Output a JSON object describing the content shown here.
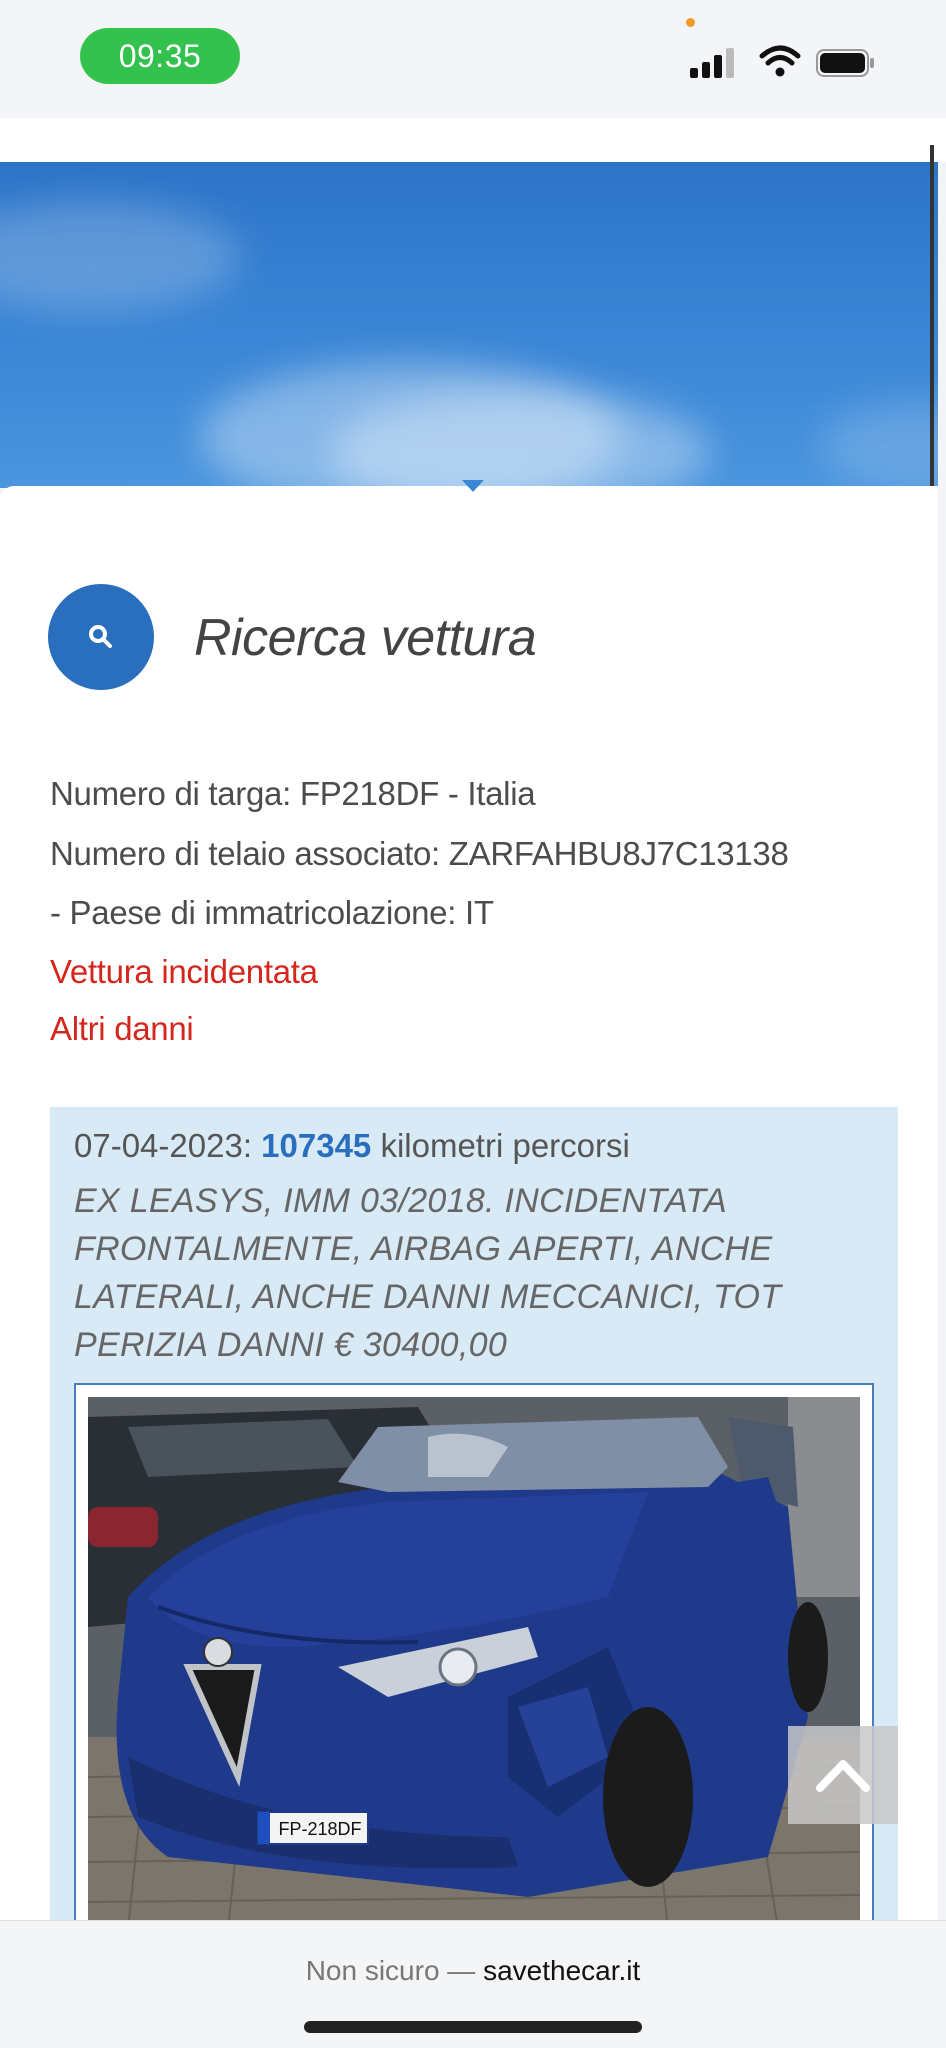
{
  "status_bar": {
    "time": "09:35",
    "icons": [
      "cellular-signal-icon",
      "wifi-icon",
      "battery-icon"
    ],
    "accent_color": "#33c24d"
  },
  "search_section": {
    "icon": "search-icon",
    "title": "Ricerca vettura"
  },
  "vehicle": {
    "plate_line": "Numero di targa: FP218DF - Italia",
    "vin_line": "Numero di telaio associato: ZARFAHBU8J7C13138",
    "country_line": "- Paese di immatricolazione: IT",
    "flag_accident": "Vettura incidentata",
    "flag_other_damage": "Altri danni",
    "alert_color": "#d5261e"
  },
  "record": {
    "date": "07-04-2023",
    "separator": ": ",
    "km": "107345",
    "km_suffix": " kilometri percorsi",
    "description": "EX LEASYS, IMM 03/2018. INCIDENTATA FRONTALMENTE, AIRBAG APERTI, ANCHE LATERALI, ANCHE DANNI MECCANICI, TOT PERIZIA DANNI € 30400,00",
    "photo_plate": "FP-218DF"
  },
  "scroll_top": {
    "icon": "chevron-up-icon"
  },
  "address_bar": {
    "insecure_label": "Non sicuro",
    "dash": " — ",
    "domain": "savethecar.it"
  }
}
